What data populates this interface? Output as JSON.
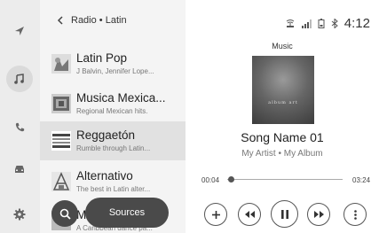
{
  "header": {
    "back_icon": "chevron-left-icon",
    "breadcrumb": "Radio • Latin"
  },
  "rail": {
    "items": [
      {
        "icon": "navigation-arrow-icon",
        "active": false
      },
      {
        "icon": "music-note-icon",
        "active": true
      },
      {
        "icon": "phone-icon",
        "active": false
      },
      {
        "icon": "car-icon",
        "active": false
      },
      {
        "icon": "settings-icon",
        "active": false
      }
    ]
  },
  "stations": [
    {
      "title": "Latin Pop",
      "subtitle": "J Balvin, Jennifer Lope...",
      "icon": "latin-pop-thumbnail"
    },
    {
      "title": "Musica Mexica...",
      "subtitle": "Regional Mexican hits.",
      "icon": "musica-mexicana-thumbnail"
    },
    {
      "title": "Reggaetón",
      "subtitle": "Rumble through Latin...",
      "icon": "reggaeton-thumbnail",
      "selected": true
    },
    {
      "title": "Alternativo",
      "subtitle": "The best in Latin alter...",
      "icon": "alternativo-thumbnail"
    },
    {
      "title": "Mu",
      "subtitle": "A Caribbean dance pa...",
      "icon": "music-station-thumbnail"
    }
  ],
  "overlay": {
    "search_icon": "search-icon",
    "sources_label": "Sources"
  },
  "status_bar": {
    "icons": [
      "wireless-charging-icon",
      "signal-icon",
      "battery-icon",
      "bluetooth-icon"
    ],
    "time": "4:12"
  },
  "now_playing": {
    "source_label": "Music",
    "album_art_text": "album art",
    "song": "Song Name 01",
    "artist_album": "My Artist • My Album",
    "elapsed": "00:04",
    "total": "03:24",
    "progress": 0.02
  },
  "controls": [
    "add-icon",
    "rewind-icon",
    "pause-icon",
    "fast-forward-icon",
    "more-options-icon"
  ]
}
